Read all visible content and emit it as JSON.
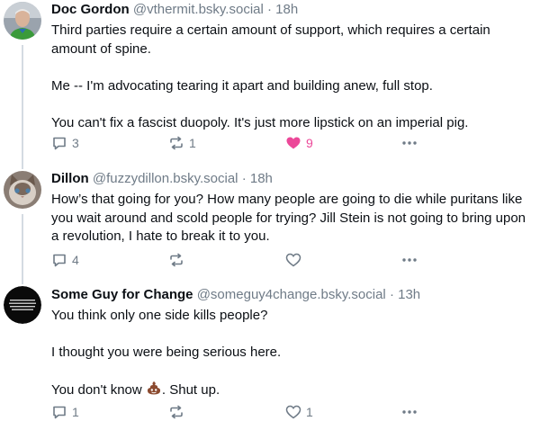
{
  "posts": [
    {
      "author": "Doc Gordon",
      "handle": "@vthermit.bsky.social",
      "dot": "·",
      "time": "18h",
      "paragraphs": [
        "Third parties require a certain amount of support, which requires a certain amount of spine.",
        "Me -- I'm advocating tearing it apart and building anew, full stop.",
        "You can't fix a fascist duopoly. It's just more lipstick on an imperial pig."
      ],
      "replies": "3",
      "reposts": "1",
      "likes": "9"
    },
    {
      "author": "Dillon",
      "handle": "@fuzzydillon.bsky.social",
      "dot": "·",
      "time": "18h",
      "paragraphs": [
        "How’s that going for you? How many people are going to die while puritans like you wait around and scold people for trying? Jill Stein is not going to bring upon a revolution, I hate to break it to you."
      ],
      "replies": "4"
    },
    {
      "author": "Some Guy for Change",
      "handle": "@someguy4change.bsky.social",
      "dot": "·",
      "time": "13h",
      "paragraphs": [
        "You think only one side kills people?",
        "I thought you were being serious here."
      ],
      "last_line_before": "You don't know",
      "last_line_after": ". Shut up.",
      "replies": "1",
      "likes": "1"
    }
  ],
  "colors": {
    "like_active": "#ec4899",
    "muted": "#6f7b87",
    "thread_line": "#d4dbe2"
  },
  "icons": [
    "reply-icon",
    "repost-icon",
    "heart-icon",
    "more-icon",
    "poop-emoji"
  ]
}
